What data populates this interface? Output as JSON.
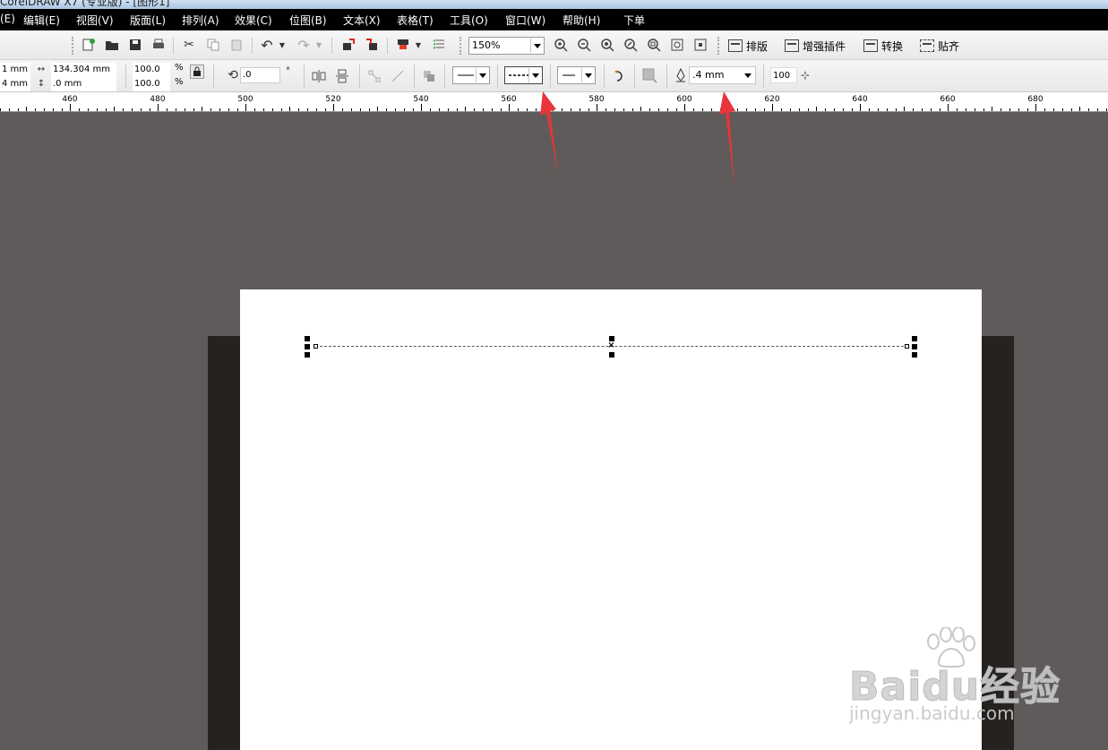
{
  "window": {
    "title": "CorelDRAW X7 (专业版) - [图形1]"
  },
  "menu": [
    "(E)",
    "编辑(E)",
    "视图(V)",
    "版面(L)",
    "排列(A)",
    "效果(C)",
    "位图(B)",
    "文本(X)",
    "表格(T)",
    "工具(O)",
    "窗口(W)",
    "帮助(H)",
    "下单"
  ],
  "toolbar": {
    "zoom_value": "150%",
    "buttons": {
      "layout": "排版",
      "enhance_plugin": "增强插件",
      "convert": "转换",
      "snap": "贴齐"
    }
  },
  "properties": {
    "x_value": "1 mm",
    "y_value": "4 mm",
    "width_value": "134.304 mm",
    "height_value": ".0 mm",
    "scale_x": "100.0",
    "scale_y": "100.0",
    "percent": "%",
    "rotation": ".0",
    "degree": "°",
    "outline_width": ".4 mm",
    "opacity_value": "100"
  },
  "ruler": {
    "labels": [
      "460",
      "480",
      "500",
      "520",
      "540",
      "560",
      "580",
      "600",
      "620",
      "640",
      "660",
      "680"
    ]
  },
  "annotations": {
    "arrow_color": "#e8343a"
  },
  "watermark": {
    "brand": "Baidu经验",
    "url": "jingyan.baidu.com"
  }
}
